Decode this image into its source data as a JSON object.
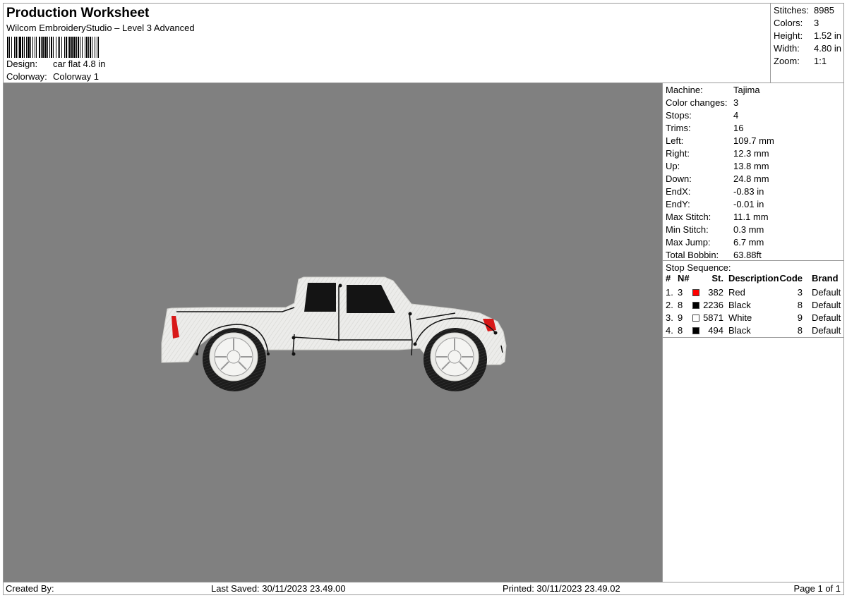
{
  "header": {
    "title": "Production Worksheet",
    "subtitle": "Wilcom EmbroideryStudio – Level 3 Advanced",
    "design_label": "Design:",
    "design_value": "car flat 4.8 in",
    "colorway_label": "Colorway:",
    "colorway_value": "Colorway 1"
  },
  "stats": [
    {
      "label": "Stitches:",
      "value": "8985"
    },
    {
      "label": "Colors:",
      "value": "3"
    },
    {
      "label": "Height:",
      "value": "1.52 in"
    },
    {
      "label": "Width:",
      "value": "4.80 in"
    },
    {
      "label": "Zoom:",
      "value": "1:1"
    }
  ],
  "machine_info": [
    {
      "label": "Machine:",
      "value": "Tajima"
    },
    {
      "label": "Color changes:",
      "value": "3"
    },
    {
      "label": "Stops:",
      "value": "4"
    },
    {
      "label": "Trims:",
      "value": "16"
    },
    {
      "label": "Left:",
      "value": "109.7 mm"
    },
    {
      "label": "Right:",
      "value": "12.3 mm"
    },
    {
      "label": "Up:",
      "value": "13.8 mm"
    },
    {
      "label": "Down:",
      "value": "24.8 mm"
    },
    {
      "label": "EndX:",
      "value": "-0.83 in"
    },
    {
      "label": "EndY:",
      "value": "-0.01 in"
    },
    {
      "label": "Max Stitch:",
      "value": "11.1 mm"
    },
    {
      "label": "Min Stitch:",
      "value": "0.3 mm"
    },
    {
      "label": "Max Jump:",
      "value": "6.7 mm"
    },
    {
      "label": "Total Bobbin:",
      "value": "63.88ft"
    }
  ],
  "stop_sequence": {
    "title": "Stop Sequence:",
    "columns": {
      "num": "#",
      "n": "N#",
      "st": "St.",
      "description": "Description",
      "code": "Code",
      "brand": "Brand"
    },
    "rows": [
      {
        "num": "1.",
        "n": "3",
        "color": "#ff0000",
        "st": "382",
        "description": "Red",
        "code": "3",
        "brand": "Default"
      },
      {
        "num": "2.",
        "n": "8",
        "color": "#000000",
        "st": "2236",
        "description": "Black",
        "code": "8",
        "brand": "Default"
      },
      {
        "num": "3.",
        "n": "9",
        "color": "#ffffff",
        "st": "5871",
        "description": "White",
        "code": "9",
        "brand": "Default"
      },
      {
        "num": "4.",
        "n": "8",
        "color": "#000000",
        "st": "494",
        "description": "Black",
        "code": "8",
        "brand": "Default"
      }
    ]
  },
  "footer": {
    "created_by": "Created By:",
    "last_saved": "Last Saved: 30/11/2023 23.49.00",
    "printed": "Printed: 30/11/2023 23.49.02",
    "page": "Page 1 of 1"
  },
  "canvas": {
    "background": "#808080",
    "design_image": "pickup-truck-embroidery"
  }
}
